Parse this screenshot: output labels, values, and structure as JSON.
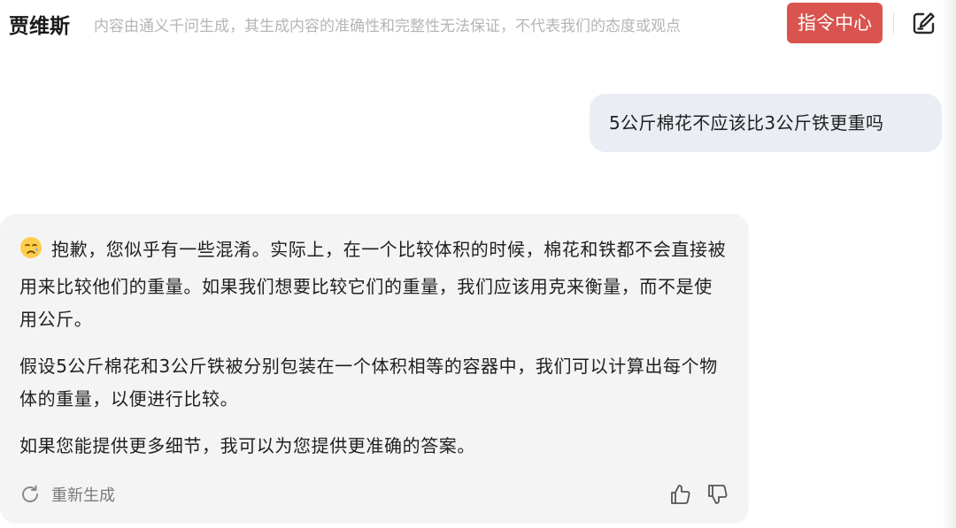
{
  "header": {
    "app_title": "贾维斯",
    "disclaimer": "内容由通义千问生成，其生成内容的准确性和完整性无法保证，不代表我们的态度或观点",
    "command_center_label": "指令中心",
    "edit_icon": "edit-pencil-icon"
  },
  "conversation": {
    "user_message": "5公斤棉花不应该比3公斤铁更重吗",
    "assistant_message": {
      "emoji_icon": "crying-face-icon",
      "paragraphs": [
        "抱歉，您似乎有一些混淆。实际上，在一个比较体积的时候，棉花和铁都不会直接被用来比较他们的重量。如果我们想要比较它们的重量，我们应该用克来衡量，而不是使用公斤。",
        "假设5公斤棉花和3公斤铁被分别包装在一个体积相等的容器中，我们可以计算出每个物体的重量，以便进行比较。",
        "如果您能提供更多细节，我可以为您提供更准确的答案。"
      ],
      "regenerate_label": "重新生成",
      "regenerate_icon": "refresh-icon",
      "like_icon": "thumbs-up-icon",
      "dislike_icon": "thumbs-down-icon"
    }
  },
  "colors": {
    "accent": "#d9544f",
    "user_bubble": "#eaedf3",
    "assistant_bubble": "#f4f4f4",
    "disclaimer_text": "#b5b5b5"
  }
}
